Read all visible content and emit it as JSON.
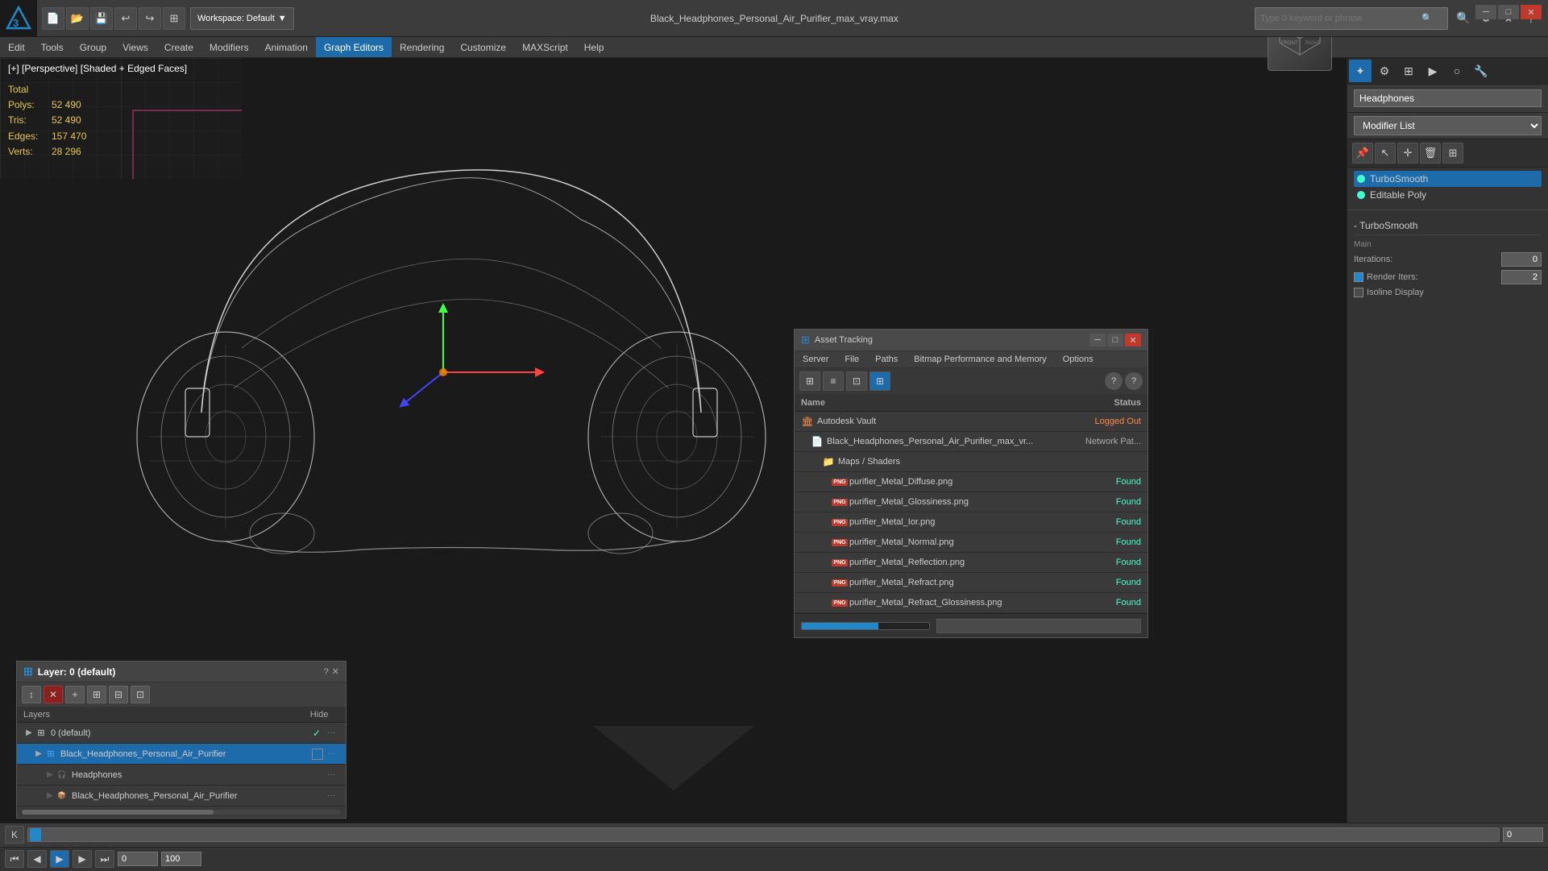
{
  "app": {
    "title": "Black_Headphones_Personal_Air_Purifier_max_vray.max",
    "workspace_label": "Workspace: Default"
  },
  "search": {
    "placeholder": "Type 0 keyword or phrase"
  },
  "window_controls": {
    "minimize": "─",
    "restore": "□",
    "close": "✕"
  },
  "menu": {
    "items": [
      "Edit",
      "Tools",
      "Group",
      "Views",
      "Create",
      "Modifiers",
      "Animation",
      "Graph Editors",
      "Rendering",
      "Customize",
      "MAXScript",
      "Help"
    ]
  },
  "viewport": {
    "label": "[+] [Perspective] [Shaded + Edged Faces]",
    "stats": {
      "total_label": "Total",
      "polys_label": "Polys:",
      "polys_value": "52 490",
      "tris_label": "Tris:",
      "tris_value": "52 490",
      "edges_label": "Edges:",
      "edges_value": "157 470",
      "verts_label": "Verts:",
      "verts_value": "28 296"
    }
  },
  "right_panel": {
    "object_name": "Headphones",
    "modifier_list_label": "Modifier List",
    "modifiers": [
      {
        "name": "TurboSmooth",
        "active": true
      },
      {
        "name": "Editable Poly",
        "active": true
      }
    ],
    "turbosmooth": {
      "section": "- TurboSmooth",
      "main_label": "Main",
      "iterations_label": "Iterations:",
      "iterations_value": "0",
      "render_iters_label": "Render Iters:",
      "render_iters_value": "2",
      "isoline_label": "Isoline Display"
    }
  },
  "layer_panel": {
    "title": "Layer: 0 (default)",
    "header": {
      "name_col": "Layers",
      "hide_col": "Hide"
    },
    "toolbar_icons": [
      "↕",
      "✕",
      "+",
      "⊞",
      "⊟",
      "⊞"
    ],
    "rows": [
      {
        "indent": 0,
        "icon": "▶",
        "name": "0 (default)",
        "checked": true,
        "has_square": false,
        "dots": "···"
      },
      {
        "indent": 1,
        "icon": "▶",
        "name": "Black_Headphones_Personal_Air_Purifier",
        "checked": false,
        "has_square": true,
        "dots": "···",
        "selected": true
      },
      {
        "indent": 2,
        "icon": "",
        "name": "Headphones",
        "checked": false,
        "has_square": false,
        "dots": "···"
      },
      {
        "indent": 2,
        "icon": "",
        "name": "Black_Headphones_Personal_Air_Purifier",
        "checked": false,
        "has_square": false,
        "dots": "···"
      }
    ]
  },
  "asset_panel": {
    "title": "Asset Tracking",
    "menu": [
      "Server",
      "File",
      "Paths",
      "Bitmap Performance and Memory",
      "Options"
    ],
    "toolbar_icons": [
      {
        "icon": "⊞",
        "active": false
      },
      {
        "icon": "≡",
        "active": false
      },
      {
        "icon": "⊡",
        "active": false
      },
      {
        "icon": "⊞",
        "active": true
      }
    ],
    "table": {
      "col_name": "Name",
      "col_status": "Status"
    },
    "rows": [
      {
        "indent": 0,
        "icon": "vault",
        "name": "Autodesk Vault",
        "status": "Logged Out",
        "status_class": "status-logged-out"
      },
      {
        "indent": 1,
        "icon": "file",
        "name": "Black_Headphones_Personal_Air_Purifier_max_vr...",
        "status": "Network Pat...",
        "status_class": "status-network"
      },
      {
        "indent": 2,
        "icon": "folder",
        "name": "Maps / Shaders",
        "status": "",
        "status_class": ""
      },
      {
        "indent": 3,
        "icon": "png",
        "name": "purifier_Metal_Diffuse.png",
        "status": "Found",
        "status_class": "status-found"
      },
      {
        "indent": 3,
        "icon": "png",
        "name": "purifier_Metal_Glossiness.png",
        "status": "Found",
        "status_class": "status-found"
      },
      {
        "indent": 3,
        "icon": "png",
        "name": "purifier_Metal_Ior.png",
        "status": "Found",
        "status_class": "status-found"
      },
      {
        "indent": 3,
        "icon": "png",
        "name": "purifier_Metal_Normal.png",
        "status": "Found",
        "status_class": "status-found"
      },
      {
        "indent": 3,
        "icon": "png",
        "name": "purifier_Metal_Reflection.png",
        "status": "Found",
        "status_class": "status-found"
      },
      {
        "indent": 3,
        "icon": "png",
        "name": "purifier_Metal_Refract.png",
        "status": "Found",
        "status_class": "status-found"
      },
      {
        "indent": 3,
        "icon": "png",
        "name": "purifier_Metal_Refract_Glossiness.png",
        "status": "Found",
        "status_class": "status-found"
      }
    ]
  },
  "timeline": {
    "frame_current": "0",
    "frame_start": "0",
    "frame_end": "100"
  }
}
